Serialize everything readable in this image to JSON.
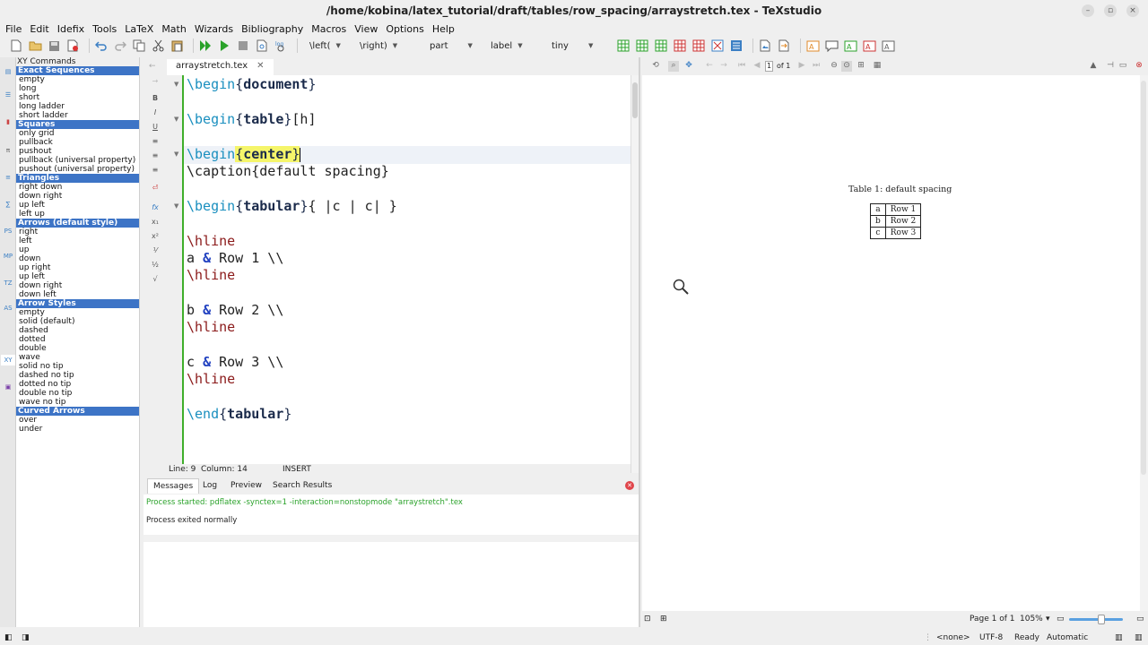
{
  "window": {
    "title": "/home/kobina/latex_tutorial/draft/tables/row_spacing/arraystretch.tex - TeXstudio"
  },
  "menu": [
    "File",
    "Edit",
    "Idefix",
    "Tools",
    "LaTeX",
    "Math",
    "Wizards",
    "Bibliography",
    "Macros",
    "View",
    "Options",
    "Help"
  ],
  "toolbar": {
    "left_combo": "\\left(",
    "right_combo": "\\right)",
    "section_combo": "part",
    "label_combo": "label",
    "size_combo": "tiny"
  },
  "xy_panel": {
    "header": "XY Commands",
    "groups": [
      {
        "title": "Exact Sequences",
        "items": [
          "empty",
          "long",
          "short",
          "long ladder",
          "short ladder"
        ]
      },
      {
        "title": "Squares",
        "items": [
          "only grid",
          "pullback",
          "pushout",
          "pullback (universal property)",
          "pushout (universal property)"
        ]
      },
      {
        "title": "Triangles",
        "items": [
          "right down",
          "down right",
          "up left",
          "left up"
        ]
      },
      {
        "title": "Arrows (default style)",
        "items": [
          "right",
          "left",
          "up",
          "down",
          "up right",
          "up left",
          "down right",
          "down left"
        ]
      },
      {
        "title": "Arrow Styles",
        "items": [
          "empty",
          "solid (default)",
          "dashed",
          "dotted",
          "double",
          "wave",
          "solid no tip",
          "dashed no tip",
          "dotted no tip",
          "double no tip",
          "wave no tip"
        ]
      },
      {
        "title": "Curved Arrows",
        "items": [
          "over",
          "under"
        ]
      }
    ]
  },
  "left_strip": [
    "PS",
    "MP",
    "TZ",
    "AS",
    "XY"
  ],
  "editor": {
    "tab_label": "arraystretch.tex",
    "lines": {
      "l1_kw": "\\begin",
      "l1_env": "document",
      "l3_kw": "\\begin",
      "l3_env": "table",
      "l3_opt": "[h]",
      "l5_kw": "\\begin",
      "l5_env": "center",
      "l6": "\\caption{default spacing}",
      "l8_kw": "\\begin",
      "l8_env": "tabular",
      "l8_args": "{ |c | c| }",
      "hline": "\\hline",
      "row1_a": "a ",
      "row1_b": " Row 1 \\\\",
      "row2_a": "b ",
      "row2_b": " Row 2 \\\\",
      "row3_a": "c ",
      "row3_b": " Row 3 \\\\",
      "amp": "&",
      "end_kw": "\\end",
      "end_env": "tabular"
    },
    "status": {
      "line": "Line: 9",
      "column": "Column: 14",
      "mode": "INSERT"
    }
  },
  "messages": {
    "tabs": [
      "Messages",
      "Log",
      "Preview",
      "Search Results"
    ],
    "lines": [
      "Process started: pdflatex -synctex=1 -interaction=nonstopmode \"arraystretch\".tex",
      "Process exited normally"
    ]
  },
  "pdf": {
    "page_input": "1",
    "page_of": "of 1",
    "caption": "Table 1: default spacing",
    "table": [
      [
        "a",
        "Row 1"
      ],
      [
        "b",
        "Row 2"
      ],
      [
        "c",
        "Row 3"
      ]
    ],
    "page_status": "Page 1 of 1",
    "zoom": "105%"
  },
  "status_bar": {
    "language": "<none>",
    "encoding": "UTF-8",
    "state": "Ready",
    "mode": "Automatic"
  },
  "colors": {
    "accent": "#3d74c6",
    "keyword": "#1a8fbf",
    "command": "#8b1a1a",
    "success": "#2aa22a"
  }
}
